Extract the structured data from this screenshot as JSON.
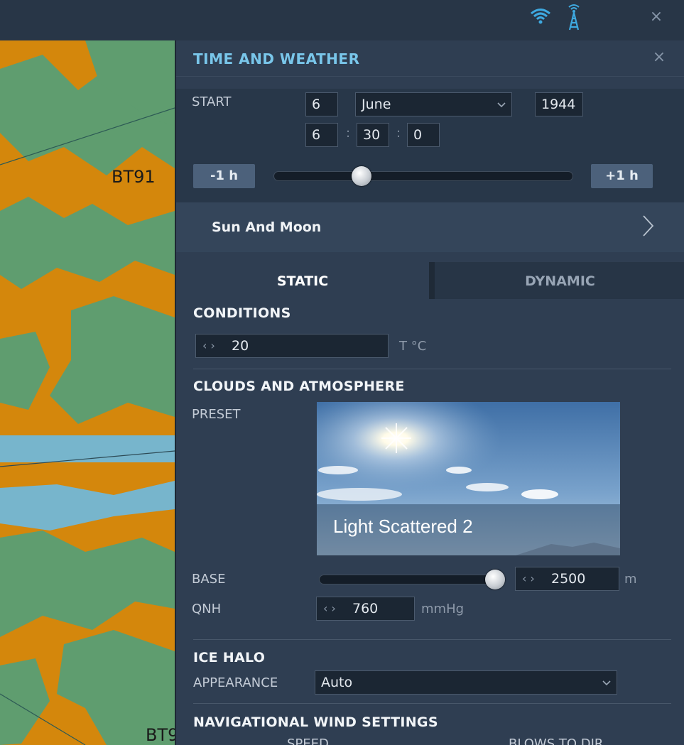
{
  "map": {
    "labels": [
      "BT91",
      "BT9"
    ]
  },
  "panel": {
    "title": "TIME AND WEATHER"
  },
  "start": {
    "label": "START",
    "day": "6",
    "month": "June",
    "year": "1944",
    "hour": "6",
    "minute": "30",
    "second": "0",
    "separator": ":",
    "minus_button": "-1 h",
    "plus_button": "+1 h",
    "time_slider_fraction": 0.28
  },
  "sun_moon": {
    "label": "Sun And Moon"
  },
  "tabs": [
    {
      "label": "STATIC",
      "active": true
    },
    {
      "label": "DYNAMIC",
      "active": false
    }
  ],
  "conditions": {
    "title": "CONDITIONS",
    "temperature": "20",
    "temperature_unit": "T °C"
  },
  "clouds": {
    "title": "CLOUDS AND ATMOSPHERE",
    "preset_label": "PRESET",
    "preset_name": "Light Scattered 2",
    "base_label": "BASE",
    "base_value": "2500",
    "base_unit": "m",
    "base_slider_fraction": 1.0,
    "qnh_label": "QNH",
    "qnh_value": "760",
    "qnh_unit": "mmHg"
  },
  "ice_halo": {
    "title": "ICE HALO",
    "appearance_label": "APPEARANCE",
    "appearance_value": "Auto"
  },
  "wind": {
    "title": "NAVIGATIONAL WIND SETTINGS",
    "speed_label": "SPEED",
    "dir_label": "BLOWS TO DIR"
  },
  "icons": [
    "wifi-icon",
    "tower-icon",
    "close-icon",
    "chevron-right-icon",
    "chevron-down-icon",
    "spinner-arrows-icon"
  ],
  "colors": {
    "accent": "#79c6ea",
    "panel_bg": "#2f3e52",
    "button": "#4c617b",
    "map_orange": "#d4870c",
    "map_green": "#5f9d6f",
    "water": "#77b5cc"
  }
}
